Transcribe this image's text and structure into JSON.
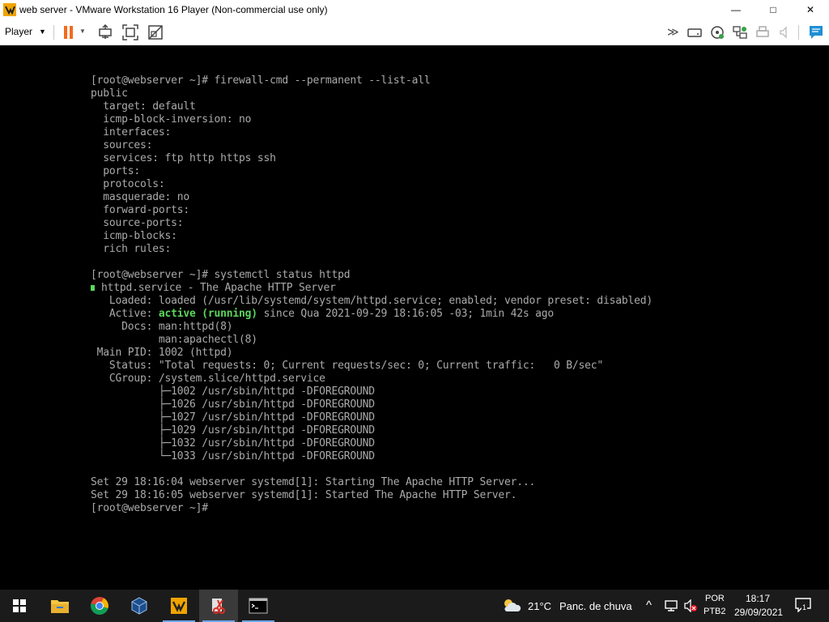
{
  "window": {
    "title": "web server - VMware Workstation 16 Player (Non-commercial use only)",
    "minimize": "—",
    "maximize": "□",
    "close": "✕"
  },
  "toolbar": {
    "player_label": "Player",
    "unity_label": "≫"
  },
  "terminal": {
    "lines": [
      "[root@webserver ~]# firewall-cmd --permanent --list-all",
      "public",
      "  target: default",
      "  icmp-block-inversion: no",
      "  interfaces:",
      "  sources:",
      "  services: ftp http https ssh",
      "  ports:",
      "  protocols:",
      "  masquerade: no",
      "  forward-ports:",
      "  source-ports:",
      "  icmp-blocks:",
      "  rich rules:",
      "",
      "[root@webserver ~]# systemctl status httpd",
      "httpd.service - The Apache HTTP Server",
      "   Loaded: loaded (/usr/lib/systemd/system/httpd.service; enabled; vendor preset: disabled)",
      "",
      "     Docs: man:httpd(8)",
      "           man:apachectl(8)",
      " Main PID: 1002 (httpd)",
      "   Status: \"Total requests: 0; Current requests/sec: 0; Current traffic:   0 B/sec\"",
      "   CGroup: /system.slice/httpd.service",
      "           ├─1002 /usr/sbin/httpd -DFOREGROUND",
      "           ├─1026 /usr/sbin/httpd -DFOREGROUND",
      "           ├─1027 /usr/sbin/httpd -DFOREGROUND",
      "           ├─1029 /usr/sbin/httpd -DFOREGROUND",
      "           ├─1032 /usr/sbin/httpd -DFOREGROUND",
      "           └─1033 /usr/sbin/httpd -DFOREGROUND",
      "",
      "Set 29 18:16:04 webserver systemd[1]: Starting The Apache HTTP Server...",
      "Set 29 18:16:05 webserver systemd[1]: Started The Apache HTTP Server.",
      "[root@webserver ~]#"
    ],
    "active_line": {
      "prefix": "   Active: ",
      "status": "active (running)",
      "suffix": " since Qua 2021-09-29 18:16:05 -03; 1min 42s ago"
    },
    "status_color": "#5cd65c"
  },
  "taskbar": {
    "weather_temp": "21°C",
    "weather_desc": "Panc. de chuva",
    "lang_top": "POR",
    "lang_bottom": "PTB2",
    "time": "18:17",
    "date": "29/09/2021",
    "notification_count": "1",
    "chevron": "^"
  }
}
